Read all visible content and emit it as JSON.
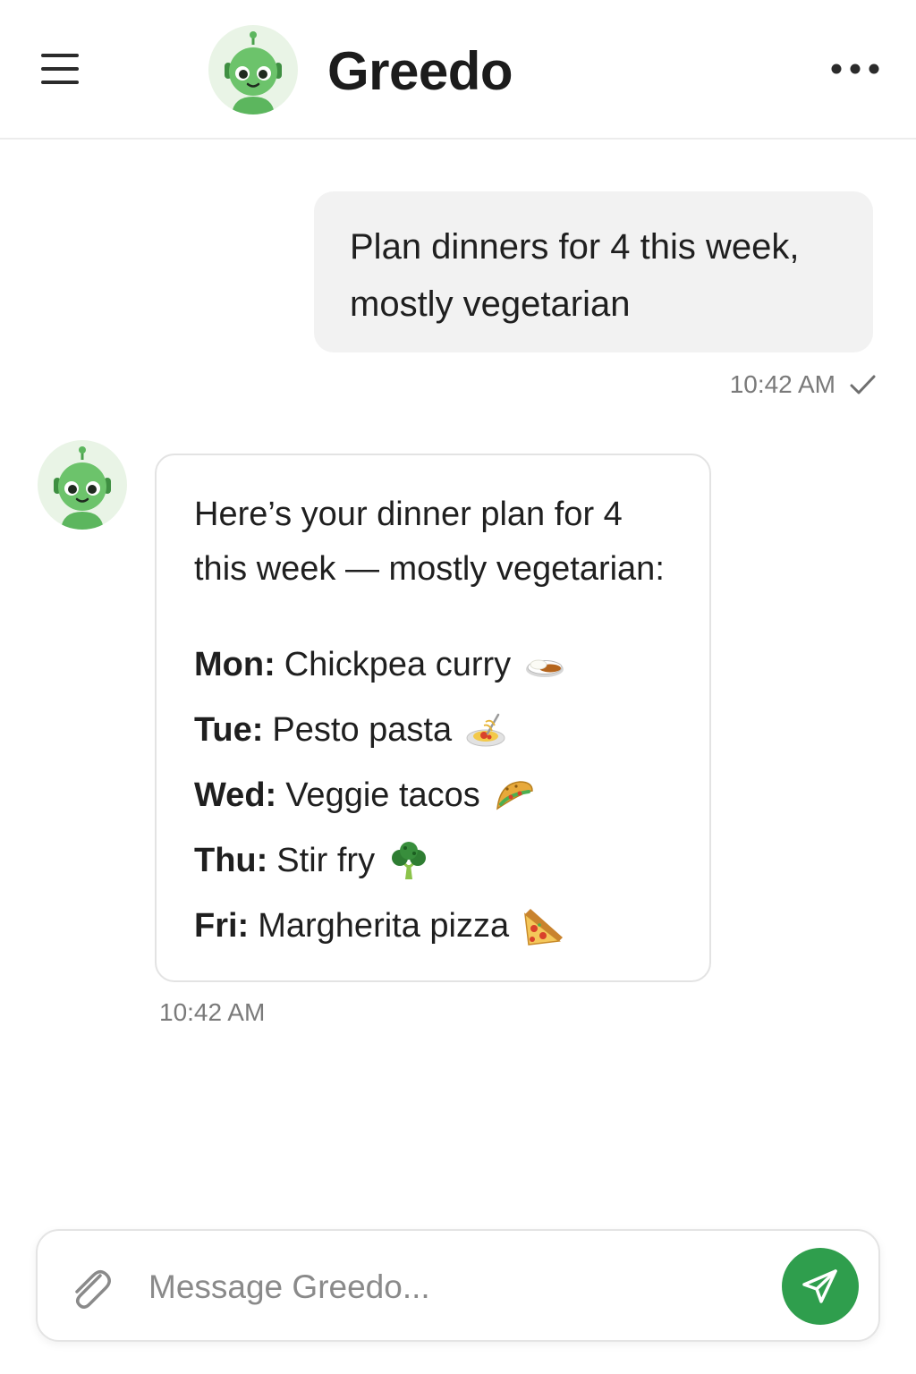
{
  "header": {
    "title": "Greedo",
    "menu_icon": "hamburger-icon",
    "more_icon": "ellipsis-icon",
    "avatar_icon": "robot-avatar-icon"
  },
  "messages": {
    "user": {
      "text": "Plan dinners for 4 this week, mostly vegetarian",
      "timestamp": "10:42 AM",
      "status_icon": "check-icon"
    },
    "bot": {
      "intro": "Here’s your dinner plan for 4 this week — mostly vegetarian:",
      "plan": [
        {
          "day": "Mon:",
          "meal": "Chickpea curry",
          "icon": "curry-rice-icon"
        },
        {
          "day": "Tue:",
          "meal": "Pesto pasta",
          "icon": "spaghetti-icon"
        },
        {
          "day": "Wed:",
          "meal": "Veggie tacos",
          "icon": "taco-icon"
        },
        {
          "day": "Thu:",
          "meal": "Stir fry",
          "icon": "broccoli-icon"
        },
        {
          "day": "Fri:",
          "meal": "Margherita pizza",
          "icon": "pizza-icon"
        }
      ],
      "timestamp": "10:42 AM"
    }
  },
  "composer": {
    "placeholder": "Message Greedo...",
    "attach_icon": "paperclip-icon",
    "send_icon": "send-icon"
  },
  "colors": {
    "accent": "#2f9e4d",
    "bot_green": "#5cb65e",
    "user_bubble": "#f2f2f2",
    "timestamp": "#7a7a7a"
  }
}
